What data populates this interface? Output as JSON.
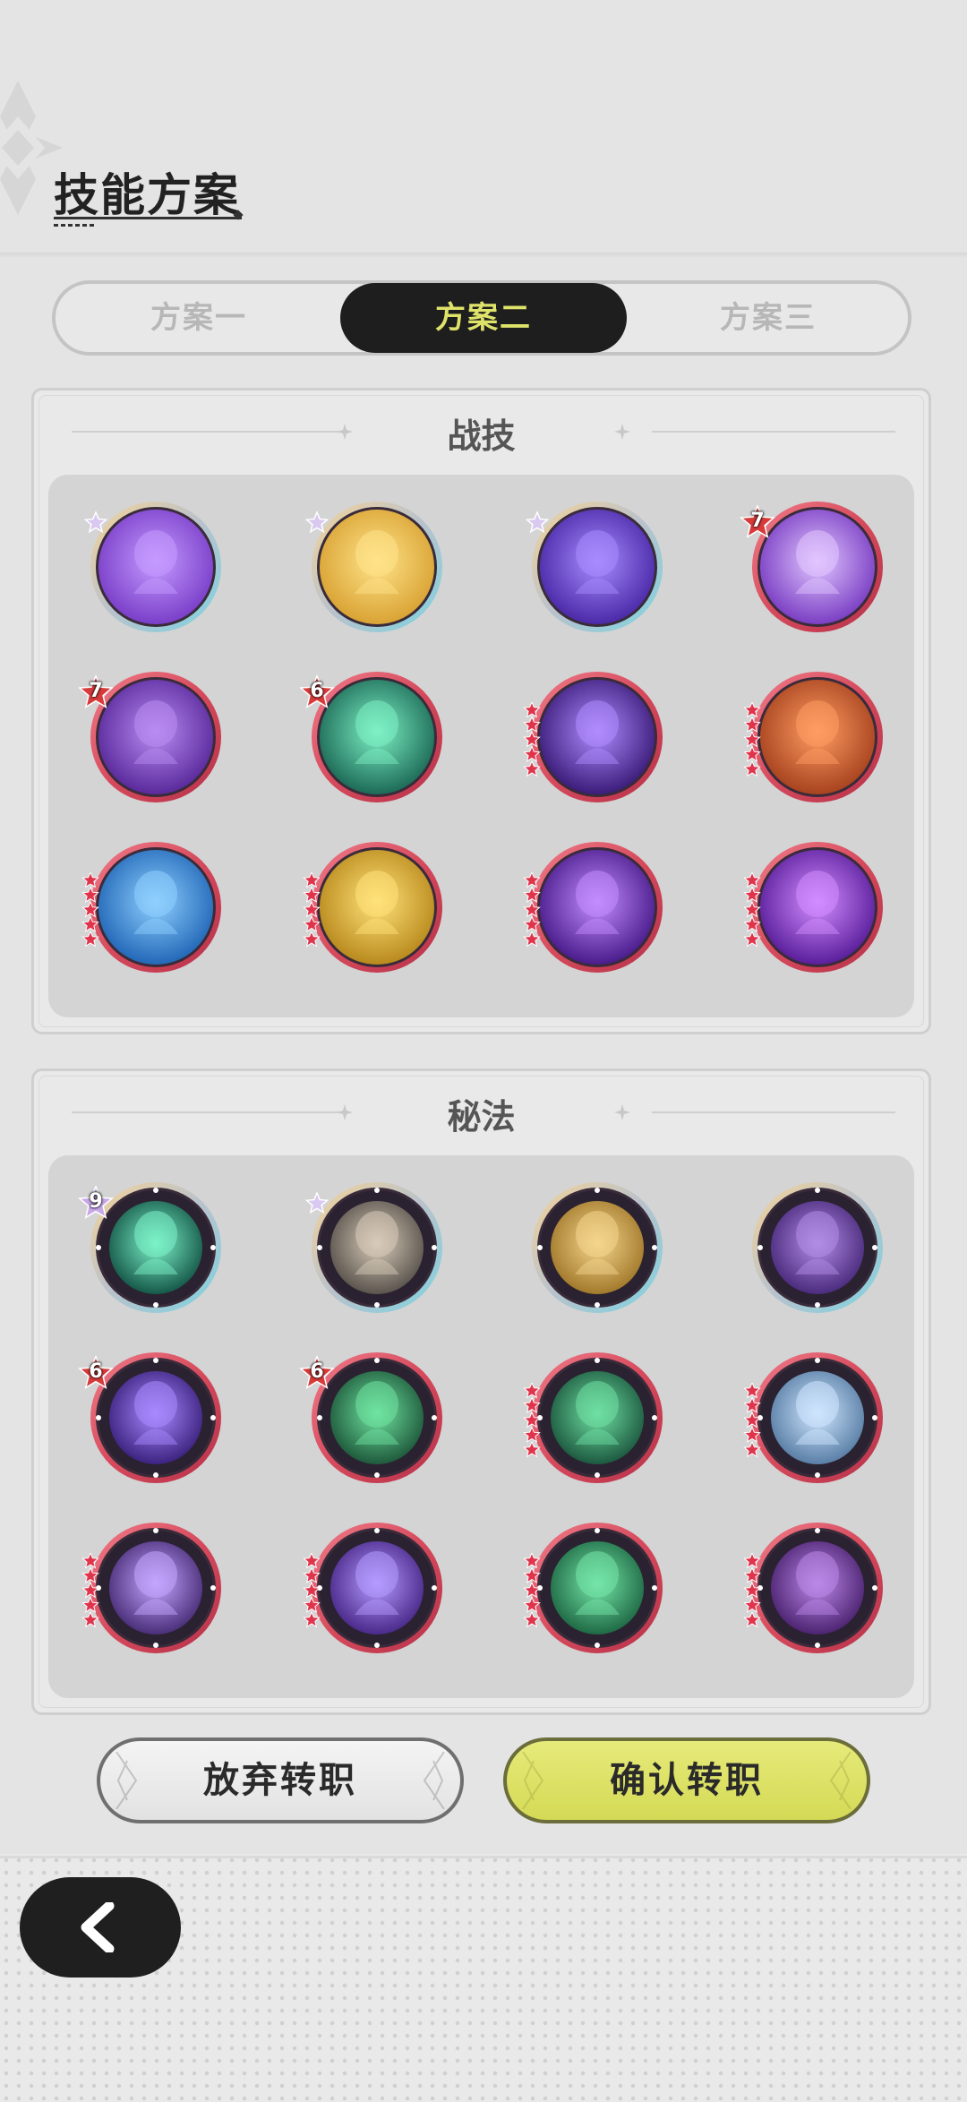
{
  "header": {
    "title": "技能方案"
  },
  "tabs": [
    {
      "label": "方案一",
      "active": false
    },
    {
      "label": "方案二",
      "active": true
    },
    {
      "label": "方案三",
      "active": false
    }
  ],
  "panels": [
    {
      "title": "战技",
      "skills": [
        {
          "icon": "purple-warrior-skill-icon",
          "frame": "silver",
          "badge": "star",
          "badge_value": "",
          "stars": 0
        },
        {
          "icon": "golden-rock-guardian-skill-icon",
          "frame": "silver",
          "badge": "star",
          "badge_value": "",
          "stars": 0
        },
        {
          "icon": "purple-vortex-skill-icon",
          "frame": "silver",
          "badge": "star",
          "badge_value": "",
          "stars": 0
        },
        {
          "icon": "purple-lotus-eye-skill-icon",
          "frame": "red",
          "badge": "number",
          "badge_value": "7",
          "stars": 0
        },
        {
          "icon": "purple-shield-skill-icon",
          "frame": "red",
          "badge": "number",
          "badge_value": "7",
          "stars": 0
        },
        {
          "icon": "green-spirit-skill-icon",
          "frame": "red",
          "badge": "number",
          "badge_value": "6",
          "stars": 0
        },
        {
          "icon": "violet-sparkle-skill-icon",
          "frame": "red",
          "badge": "none",
          "badge_value": "",
          "stars": 5
        },
        {
          "icon": "orange-cauldron-skill-icon",
          "frame": "red",
          "badge": "none",
          "badge_value": "",
          "stars": 5
        },
        {
          "icon": "blue-beast-skill-icon",
          "frame": "red",
          "badge": "none",
          "badge_value": "",
          "stars": 5
        },
        {
          "icon": "golden-heal-cross-skill-icon",
          "frame": "red",
          "badge": "none",
          "badge_value": "",
          "stars": 5
        },
        {
          "icon": "purple-eye-storm-skill-icon",
          "frame": "red",
          "badge": "none",
          "badge_value": "",
          "stars": 5
        },
        {
          "icon": "purple-hand-skill-icon",
          "frame": "red",
          "badge": "none",
          "badge_value": "",
          "stars": 5
        }
      ]
    },
    {
      "title": "秘法",
      "skills": [
        {
          "icon": "green-figure-aura-secret-icon",
          "frame": "silver-dark",
          "badge": "number",
          "badge_value": "9",
          "stars": 0
        },
        {
          "icon": "grey-figure-secret-icon",
          "frame": "silver-dark",
          "badge": "star",
          "badge_value": "",
          "stars": 0
        },
        {
          "icon": "golden-figure-secret-icon",
          "frame": "silver-dark",
          "badge": "none",
          "badge_value": "",
          "stars": 0
        },
        {
          "icon": "purple-flex-arm-secret-icon",
          "frame": "silver-dark",
          "badge": "none",
          "badge_value": "",
          "stars": 0
        },
        {
          "icon": "purple-rune-circle-secret-icon",
          "frame": "red-dark",
          "badge": "number",
          "badge_value": "6",
          "stars": 0
        },
        {
          "icon": "green-waterfall-secret-icon",
          "frame": "red-dark",
          "badge": "number",
          "badge_value": "6",
          "stars": 0
        },
        {
          "icon": "green-sparkle-secret-icon",
          "frame": "red-dark",
          "badge": "none",
          "badge_value": "",
          "stars": 5
        },
        {
          "icon": "blue-armor-secret-icon",
          "frame": "red-dark",
          "badge": "none",
          "badge_value": "",
          "stars": 5
        },
        {
          "icon": "purple-figure-up-secret-icon",
          "frame": "red-dark",
          "badge": "none",
          "badge_value": "",
          "stars": 5
        },
        {
          "icon": "purple-fist-secret-icon",
          "frame": "red-dark",
          "badge": "none",
          "badge_value": "",
          "stars": 5
        },
        {
          "icon": "green-winged-emblem-secret-icon",
          "frame": "red-dark",
          "badge": "none",
          "badge_value": "",
          "stars": 5
        },
        {
          "icon": "purple-swirl-secret-icon",
          "frame": "red-dark",
          "badge": "none",
          "badge_value": "",
          "stars": 5
        }
      ]
    }
  ],
  "palette": {
    "red_frame": "#d64a5c",
    "silver_frame": "#b9c2cc",
    "accent_yellow": "#dfe36a",
    "dark": "#1e1e1e"
  },
  "skill_colors": [
    [
      "#7a3fc9",
      "#c59bff"
    ],
    [
      "#d9a334",
      "#ffe38a"
    ],
    [
      "#4b2aa8",
      "#a88cff"
    ],
    [
      "#7b3fc4",
      "#e1c6ff"
    ],
    [
      "#5a2a9c",
      "#b98cf2"
    ],
    [
      "#1d6b57",
      "#7df0c4"
    ],
    [
      "#3b1d7a",
      "#b08cff"
    ],
    [
      "#a8431f",
      "#ff9d63"
    ],
    [
      "#2368b8",
      "#8fd0ff"
    ],
    [
      "#b98a1d",
      "#ffe27a"
    ],
    [
      "#4a1c8c",
      "#c38dff"
    ],
    [
      "#5b1f9c",
      "#d28dff"
    ],
    [
      "#16594a",
      "#7cf2c8"
    ],
    [
      "#5b554e",
      "#d8cbb9"
    ],
    [
      "#a37a2c",
      "#f4d58d"
    ],
    [
      "#4b2c7e",
      "#b38de6"
    ],
    [
      "#3d2380",
      "#a98aff"
    ],
    [
      "#1f5a3c",
      "#6fe3a0"
    ],
    [
      "#1d5a40",
      "#6fe0a3"
    ],
    [
      "#5a7fa6",
      "#cfe6ff"
    ],
    [
      "#4a2f7a",
      "#c5a6ff"
    ],
    [
      "#4a2a8a",
      "#b59aff"
    ],
    [
      "#1f6a45",
      "#75e6a8"
    ],
    [
      "#4d2472",
      "#bb88e8"
    ]
  ],
  "buttons": {
    "abandon": "放弃转职",
    "confirm": "确认转职"
  }
}
